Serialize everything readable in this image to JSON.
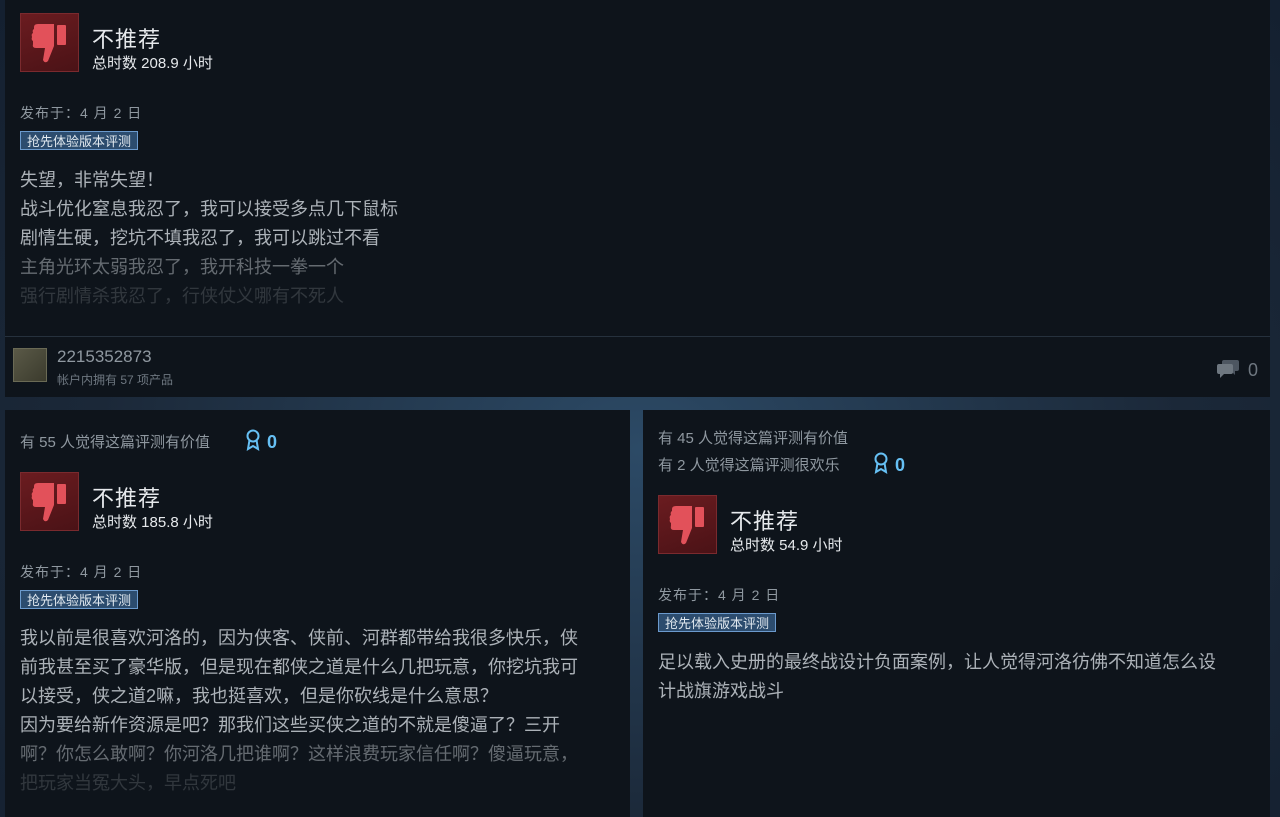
{
  "colors": {
    "accent": "#66c0f4",
    "thumb_red": "#e2515a",
    "card_bg": "#0e141b",
    "tag_bg": "#2c4c6e"
  },
  "reviews": [
    {
      "verdict": "不推荐",
      "hours": "总时数 208.9 小时",
      "posted": "发布于：4 月 2 日",
      "tag": "抢先体验版本评测",
      "lines": [
        "失望，非常失望！",
        "战斗优化窒息我忍了，我可以接受多点几下鼠标",
        "剧情生硬，挖坑不填我忍了，我可以跳过不看",
        "主角光环太弱我忍了，我开科技一拳一个",
        "强行剧情杀我忍了，行侠仗义哪有不死人"
      ],
      "author": {
        "name": "2215352873",
        "products": "帐户内拥有 57 项产品"
      },
      "comments": "0"
    },
    {
      "helpful": "有 55 人觉得这篇评测有价值",
      "awards": "0",
      "verdict": "不推荐",
      "hours": "总时数 185.8 小时",
      "posted": "发布于：4 月 2 日",
      "tag": "抢先体验版本评测",
      "lines": [
        "我以前是很喜欢河洛的，因为侠客、侠前、河群都带给我很多快乐，侠",
        "前我甚至买了豪华版，但是现在都侠之道是什么几把玩意，你挖坑我可",
        "以接受，侠之道2嘛，我也挺喜欢，但是你砍线是什么意思？",
        "因为要给新作资源是吧？那我们这些买侠之道的不就是傻逼了？三开",
        "啊？你怎么敢啊？你河洛几把谁啊？这样浪费玩家信任啊？傻逼玩意，",
        "把玩家当冤大头，早点死吧"
      ]
    },
    {
      "helpful": "有 45 人觉得这篇评测有价值",
      "funny": "有 2 人觉得这篇评测很欢乐",
      "awards": "0",
      "verdict": "不推荐",
      "hours": "总时数 54.9 小时",
      "posted": "发布于：4 月 2 日",
      "tag": "抢先体验版本评测",
      "lines": [
        "足以载入史册的最终战设计负面案例，让人觉得河洛彷佛不知道怎么设",
        "计战旗游戏战斗"
      ]
    }
  ]
}
